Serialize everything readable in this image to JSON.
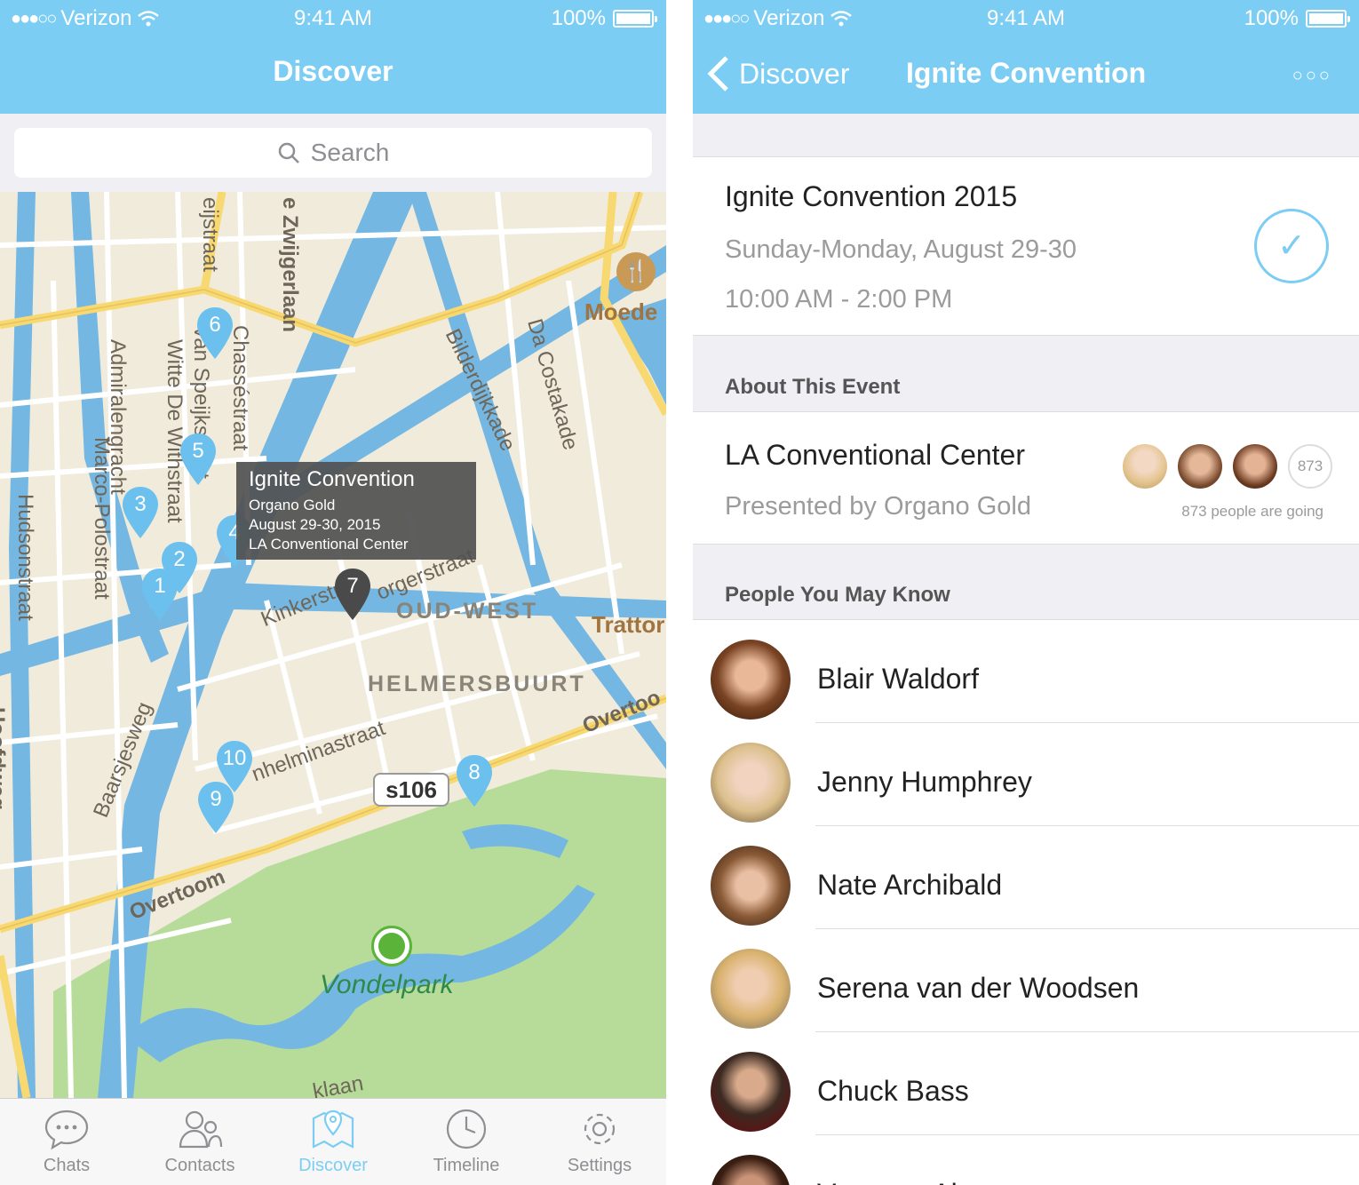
{
  "status_bar": {
    "carrier": "Verizon",
    "time": "9:41 AM",
    "battery": "100%"
  },
  "left": {
    "title": "Discover",
    "search": {
      "placeholder": "Search"
    },
    "tooltip": {
      "title": "Ignite  Convention",
      "presenter": "Organo Gold",
      "date": "August 29-30, 2015",
      "venue": "LA Conventional Center"
    },
    "pins": [
      "1",
      "2",
      "3",
      "4",
      "5",
      "6",
      "7",
      "8",
      "9",
      "10"
    ],
    "map_labels": {
      "oud_west": "OUD-WEST",
      "helmersbuurt": "HELMERSBUURT",
      "vondelpark": "Vondelpark",
      "overtoom_1": "Overtoom",
      "overtoom_2": "Overtoo",
      "kinkerstraat": "Kinkerstraat",
      "bilderdijkkade": "Bilderdijkkade",
      "da_costakade": "Da Costakade",
      "admiralengracht": "Admiralengracht",
      "marco_polostraat": "Marco-Polostraat",
      "hudsonstraat": "Hudsonstraat",
      "witte_de_withstraat": "Witte De Withstraat",
      "van_speijkstraat": "Van Speijkstraat",
      "chassestraat": "Chasséstraat",
      "zwijgerlaan": "e Zwijgerlaan",
      "eijstraat": "eijstraat",
      "baarsjesweg": "Baarsjesweg",
      "wilheminastraat": "nhelminastraat",
      "moede": "Moede",
      "tratto": "Trattor",
      "borgerstraat": "orgerstraat",
      "hoofdweg": "Hoofdweg",
      "klaan": "klaan",
      "road_shield": "s106"
    },
    "tabs": [
      {
        "label": "Chats",
        "icon": "chat-bubble-icon"
      },
      {
        "label": "Contacts",
        "icon": "contacts-icon"
      },
      {
        "label": "Discover",
        "icon": "map-pin-icon"
      },
      {
        "label": "Timeline",
        "icon": "clock-icon"
      },
      {
        "label": "Settings",
        "icon": "gear-icon"
      }
    ],
    "active_tab": "Discover"
  },
  "right": {
    "back_label": "Discover",
    "title": "Ignite Convention",
    "event": {
      "title": "Ignite Convention 2015",
      "date": "Sunday-Monday, August 29-30",
      "time": "10:00 AM - 2:00 PM",
      "checked": true
    },
    "about_header": "About This Event",
    "venue": {
      "name": "LA Conventional Center",
      "presenter": "Presented by Organo Gold",
      "attendee_count": "873",
      "going_text": "873 people are going"
    },
    "people_header": "People You May Know",
    "people": [
      {
        "name": "Blair Waldorf"
      },
      {
        "name": "Jenny Humphrey"
      },
      {
        "name": "Nate Archibald"
      },
      {
        "name": "Serena van der Woodsen"
      },
      {
        "name": "Chuck Bass"
      },
      {
        "name": "Vanessa Abrams"
      }
    ]
  },
  "colors": {
    "accent": "#7ccdf3",
    "pin_blue": "#6cc0ee",
    "pin_dark": "#4a4a4a",
    "map_bg": "#f1ebdc",
    "water": "#74b7e2",
    "park": "#b7dc9a",
    "major_road": "#f7d871"
  }
}
